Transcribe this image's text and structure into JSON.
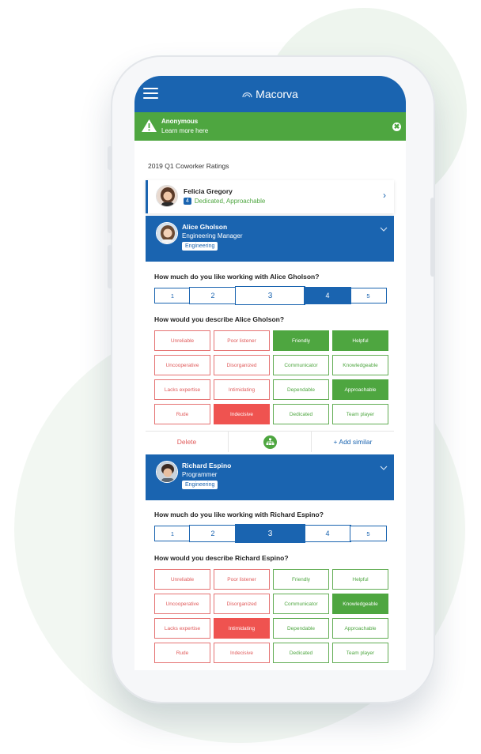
{
  "app": {
    "brand": "Macorva"
  },
  "banner": {
    "title": "Anonymous",
    "subtitle": "Learn more here",
    "close_glyph": "✖"
  },
  "section_title": "2019 Q1 Coworker Ratings",
  "collapsed_card": {
    "name": "Felicia Gregory",
    "count": "4",
    "traits": "Dedicated, Approachable",
    "chevron": "›"
  },
  "people": [
    {
      "name": "Alice Gholson",
      "role": "Engineering Manager",
      "department": "Engineering",
      "question_like": "How much do you like working with Alice Gholson?",
      "scale": [
        "1",
        "2",
        "3",
        "4",
        "5"
      ],
      "selected_rating": "4",
      "question_describe": "How would you describe Alice Gholson?",
      "tags": [
        {
          "label": "Unreliable",
          "kind": "neg",
          "selected": false
        },
        {
          "label": "Poor listener",
          "kind": "neg",
          "selected": false
        },
        {
          "label": "Friendly",
          "kind": "pos",
          "selected": true
        },
        {
          "label": "Helpful",
          "kind": "pos",
          "selected": true
        },
        {
          "label": "Uncooperative",
          "kind": "neg",
          "selected": false
        },
        {
          "label": "Disorganized",
          "kind": "neg",
          "selected": false
        },
        {
          "label": "Communicator",
          "kind": "pos",
          "selected": false
        },
        {
          "label": "Knowledgeable",
          "kind": "pos",
          "selected": false
        },
        {
          "label": "Lacks expertise",
          "kind": "neg",
          "selected": false
        },
        {
          "label": "Intimidating",
          "kind": "neg",
          "selected": false
        },
        {
          "label": "Dependable",
          "kind": "pos",
          "selected": false
        },
        {
          "label": "Approachable",
          "kind": "pos",
          "selected": true
        },
        {
          "label": "Rude",
          "kind": "neg",
          "selected": false
        },
        {
          "label": "Indecisive",
          "kind": "neg",
          "selected": true
        },
        {
          "label": "Dedicated",
          "kind": "pos",
          "selected": false
        },
        {
          "label": "Team player",
          "kind": "pos",
          "selected": false
        }
      ],
      "actions": {
        "delete": "Delete",
        "add_similar": "+ Add similar"
      }
    },
    {
      "name": "Richard Espino",
      "role": "Programmer",
      "department": "Engineering",
      "question_like": "How much do you like working with Richard Espino?",
      "scale": [
        "1",
        "2",
        "3",
        "4",
        "5"
      ],
      "selected_rating": "3",
      "question_describe": "How would you describe Richard Espino?",
      "tags": [
        {
          "label": "Unreliable",
          "kind": "neg",
          "selected": false
        },
        {
          "label": "Poor listener",
          "kind": "neg",
          "selected": false
        },
        {
          "label": "Friendly",
          "kind": "pos",
          "selected": false
        },
        {
          "label": "Helpful",
          "kind": "pos",
          "selected": false
        },
        {
          "label": "Uncooperative",
          "kind": "neg",
          "selected": false
        },
        {
          "label": "Disorganized",
          "kind": "neg",
          "selected": false
        },
        {
          "label": "Communicator",
          "kind": "pos",
          "selected": false
        },
        {
          "label": "Knowledgeable",
          "kind": "pos",
          "selected": true
        },
        {
          "label": "Lacks expertise",
          "kind": "neg",
          "selected": false
        },
        {
          "label": "Intimidating",
          "kind": "neg",
          "selected": true
        },
        {
          "label": "Dependable",
          "kind": "pos",
          "selected": false
        },
        {
          "label": "Approachable",
          "kind": "pos",
          "selected": false
        },
        {
          "label": "Rude",
          "kind": "neg",
          "selected": false
        },
        {
          "label": "Indecisive",
          "kind": "neg",
          "selected": false
        },
        {
          "label": "Dedicated",
          "kind": "pos",
          "selected": false
        },
        {
          "label": "Team player",
          "kind": "pos",
          "selected": false
        }
      ]
    }
  ],
  "icons": {
    "menu": "hamburger-menu-icon",
    "brand": "macorva-logo-icon",
    "warning": "warning-triangle-icon",
    "close": "close-circle-icon",
    "org": "org-chart-icon",
    "chevron_down": "chevron-down-icon",
    "chevron_right": "chevron-right-icon"
  },
  "colors": {
    "primary_blue": "#1a64b0",
    "success_green": "#4ea640",
    "negative_red": "#ef5350"
  }
}
